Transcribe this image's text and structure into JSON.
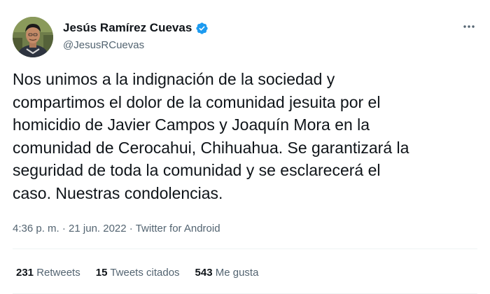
{
  "author": {
    "display_name": "Jesús Ramírez Cuevas",
    "handle": "@JesusRCuevas",
    "verified": true
  },
  "tweet": {
    "lines": [
      "Nos unimos a la indignación de la sociedad y",
      "compartimos el dolor de la comunidad jesuita por el",
      "homicidio de Javier Campos y Joaquín Mora en la",
      "comunidad de Cerocahui, Chihuahua. Se garantizará la",
      "seguridad de toda la comunidad y se esclarecerá el",
      "caso. Nuestras condolencias."
    ]
  },
  "meta": {
    "time": "4:36 p. m.",
    "separator": " · ",
    "date": "21 jun. 2022",
    "source": "Twitter for Android"
  },
  "stats": {
    "retweets_count": "231",
    "retweets_label": " Retweets",
    "quotes_count": "15",
    "quotes_label": " Tweets citados",
    "likes_count": "543",
    "likes_label": " Me gusta"
  },
  "icons": {
    "verified": "verified-badge-icon",
    "more": "more-options-icon"
  },
  "colors": {
    "text_primary": "#0f1419",
    "text_secondary": "#536471",
    "verified_blue": "#1d9bf0",
    "divider": "#eff3f4"
  }
}
